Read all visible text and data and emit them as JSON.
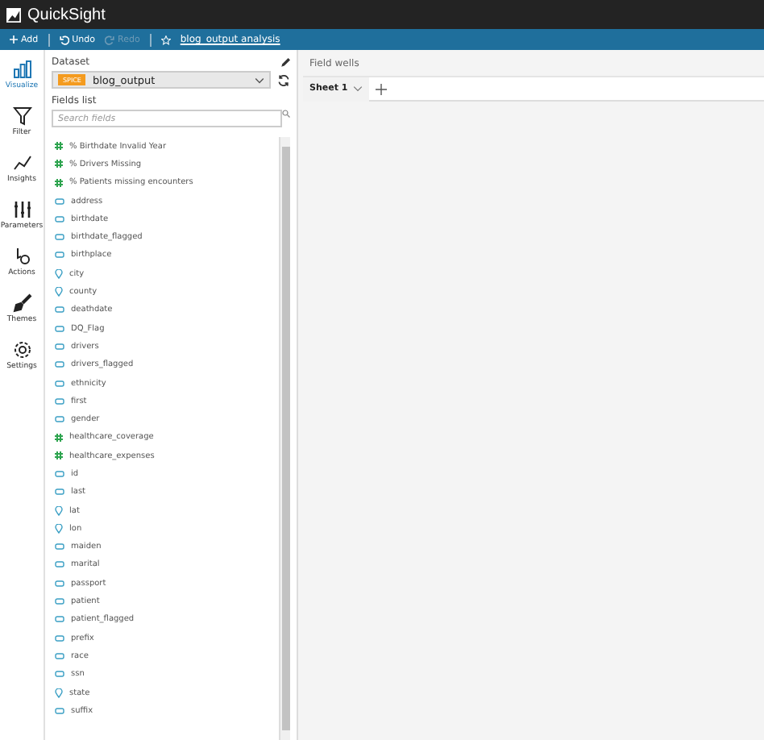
{
  "app": {
    "title": "QuickSight"
  },
  "toolbar": {
    "items": [
      {
        "kind": "add",
        "label": "Add",
        "disabled": false
      },
      {
        "kind": "undo",
        "label": "Undo",
        "disabled": false
      },
      {
        "kind": "redo",
        "label": "Redo",
        "disabled": true
      }
    ],
    "analysis_name": "blog_output analysis"
  },
  "rail": {
    "items": [
      {
        "label": "Visualize",
        "kind": "visualize",
        "selected": true
      },
      {
        "label": "Filter",
        "kind": "filter",
        "selected": false
      },
      {
        "label": "Insights",
        "kind": "insights",
        "selected": false
      },
      {
        "label": "Parameters",
        "kind": "parameters",
        "selected": false
      },
      {
        "label": "Actions",
        "kind": "actions",
        "selected": false
      },
      {
        "label": "Themes",
        "kind": "themes",
        "selected": false
      },
      {
        "label": "Settings",
        "kind": "settings",
        "selected": false
      }
    ]
  },
  "dataset": {
    "label": "Dataset",
    "badge": "SPICE",
    "name": "blog_output"
  },
  "fields": {
    "label": "Fields list",
    "placeholder": "Search fields",
    "items": [
      {
        "name": "% Birthdate Invalid Year",
        "kind": "measure"
      },
      {
        "name": "% Drivers Missing",
        "kind": "measure"
      },
      {
        "name": "% Patients missing encounters",
        "kind": "measure"
      },
      {
        "name": "address",
        "kind": "dimension"
      },
      {
        "name": "birthdate",
        "kind": "dimension"
      },
      {
        "name": "birthdate_flagged",
        "kind": "dimension"
      },
      {
        "name": "birthplace",
        "kind": "dimension"
      },
      {
        "name": "city",
        "kind": "geo"
      },
      {
        "name": "county",
        "kind": "geo"
      },
      {
        "name": "deathdate",
        "kind": "dimension"
      },
      {
        "name": "DQ_Flag",
        "kind": "dimension"
      },
      {
        "name": "drivers",
        "kind": "dimension"
      },
      {
        "name": "drivers_flagged",
        "kind": "dimension"
      },
      {
        "name": "ethnicity",
        "kind": "dimension"
      },
      {
        "name": "first",
        "kind": "dimension"
      },
      {
        "name": "gender",
        "kind": "dimension"
      },
      {
        "name": "healthcare_coverage",
        "kind": "measure"
      },
      {
        "name": "healthcare_expenses",
        "kind": "measure"
      },
      {
        "name": "id",
        "kind": "dimension"
      },
      {
        "name": "last",
        "kind": "dimension"
      },
      {
        "name": "lat",
        "kind": "geo"
      },
      {
        "name": "lon",
        "kind": "geo"
      },
      {
        "name": "maiden",
        "kind": "dimension"
      },
      {
        "name": "marital",
        "kind": "dimension"
      },
      {
        "name": "passport",
        "kind": "dimension"
      },
      {
        "name": "patient",
        "kind": "dimension"
      },
      {
        "name": "patient_flagged",
        "kind": "dimension"
      },
      {
        "name": "prefix",
        "kind": "dimension"
      },
      {
        "name": "race",
        "kind": "dimension"
      },
      {
        "name": "ssn",
        "kind": "dimension"
      },
      {
        "name": "state",
        "kind": "geo"
      },
      {
        "name": "suffix",
        "kind": "dimension"
      }
    ]
  },
  "field_wells": {
    "label": "Field wells"
  },
  "sheets": [
    {
      "label": "Sheet 1",
      "selected": true
    }
  ]
}
